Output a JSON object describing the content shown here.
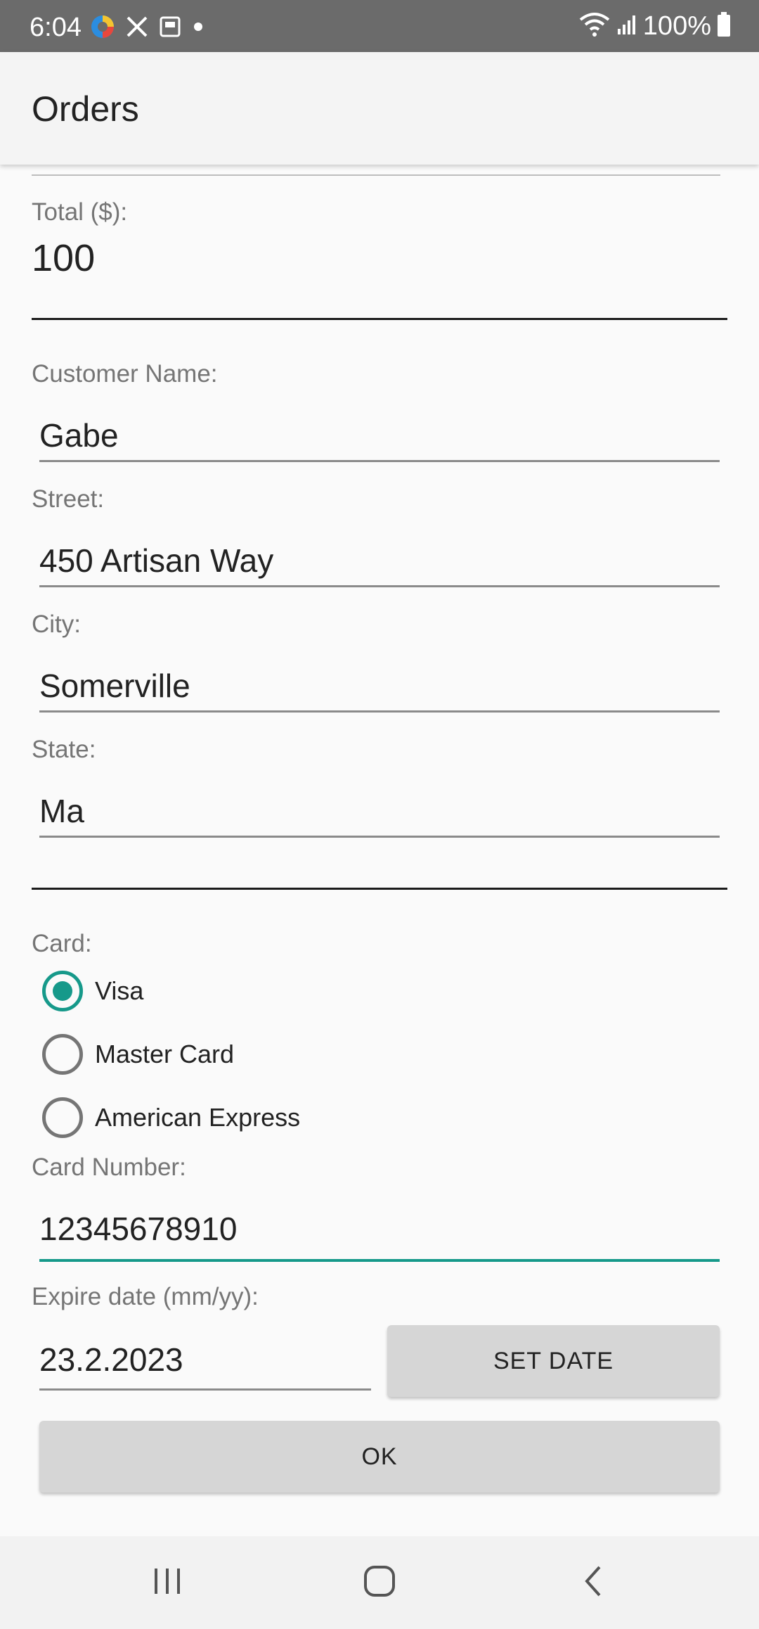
{
  "status_bar": {
    "time": "6:04",
    "battery": "100%",
    "left_icons": [
      "edge-browser-icon",
      "tools-icon",
      "storage-icon",
      "notification-dot-icon"
    ],
    "right_icons": [
      "wifi-icon",
      "signal-icon",
      "battery-icon"
    ]
  },
  "app_bar": {
    "title": "Orders"
  },
  "form": {
    "total": {
      "label": "Total ($):",
      "value": "100"
    },
    "customer_name": {
      "label": "Customer Name:",
      "value": "Gabe"
    },
    "street": {
      "label": "Street:",
      "value": "450 Artisan Way"
    },
    "city": {
      "label": "City:",
      "value": "Somerville"
    },
    "state": {
      "label": "State:",
      "value": "Ma"
    },
    "card": {
      "label": "Card:",
      "options": [
        {
          "label": "Visa",
          "selected": true
        },
        {
          "label": "Master Card",
          "selected": false
        },
        {
          "label": "American Express",
          "selected": false
        }
      ]
    },
    "card_number": {
      "label": "Card Number:",
      "value": "12345678910"
    },
    "expire_date": {
      "label": "Expire date (mm/yy):",
      "value": "23.2.2023"
    },
    "set_date_button": "SET DATE",
    "ok_button": "OK"
  },
  "colors": {
    "accent": "#16998a",
    "status_bar": "#6b6b6b",
    "button": "#d6d6d6"
  },
  "nav_bar": {
    "buttons": [
      "recents-icon",
      "home-icon",
      "back-icon"
    ]
  }
}
